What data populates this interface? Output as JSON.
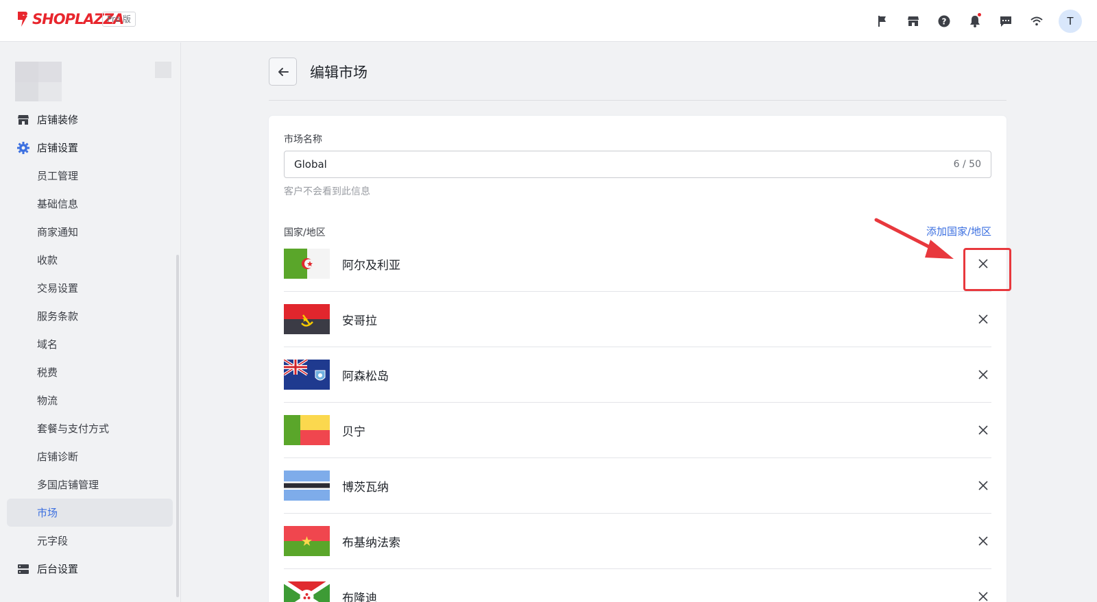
{
  "app": {
    "brand": "SHOPLAZZA",
    "edition": "Pro 版",
    "user_initial": "T"
  },
  "topbar_icons": [
    "flag-icon",
    "store-icon",
    "help-icon",
    "bell-icon",
    "chat-icon",
    "wifi-icon"
  ],
  "sidebar": {
    "items": [
      {
        "label": "店铺装修",
        "level": "top",
        "icon": "store-icon"
      },
      {
        "label": "店铺设置",
        "level": "top",
        "icon": "gear-icon"
      },
      {
        "label": "员工管理",
        "level": "sub"
      },
      {
        "label": "基础信息",
        "level": "sub"
      },
      {
        "label": "商家通知",
        "level": "sub"
      },
      {
        "label": "收款",
        "level": "sub"
      },
      {
        "label": "交易设置",
        "level": "sub"
      },
      {
        "label": "服务条款",
        "level": "sub"
      },
      {
        "label": "域名",
        "level": "sub"
      },
      {
        "label": "税费",
        "level": "sub"
      },
      {
        "label": "物流",
        "level": "sub"
      },
      {
        "label": "套餐与支付方式",
        "level": "sub"
      },
      {
        "label": "店铺诊断",
        "level": "sub"
      },
      {
        "label": "多国店铺管理",
        "level": "sub"
      },
      {
        "label": "市场",
        "level": "sub",
        "active": true
      },
      {
        "label": "元字段",
        "level": "sub"
      },
      {
        "label": "后台设置",
        "level": "top",
        "icon": "server-icon"
      }
    ]
  },
  "page": {
    "title": "编辑市场"
  },
  "form": {
    "market_name_label": "市场名称",
    "market_name_value": "Global",
    "market_name_counter": "6 / 50",
    "hint": "客户不会看到此信息",
    "regions_label": "国家/地区",
    "add_region": "添加国家/地区"
  },
  "countries": [
    {
      "name": "阿尔及利亚",
      "flag": "algeria-flag"
    },
    {
      "name": "安哥拉",
      "flag": "angola-flag"
    },
    {
      "name": "阿森松岛",
      "flag": "ascension-flag"
    },
    {
      "name": "贝宁",
      "flag": "benin-flag"
    },
    {
      "name": "博茨瓦纳",
      "flag": "botswana-flag"
    },
    {
      "name": "布基纳法索",
      "flag": "burkina-faso-flag"
    },
    {
      "name": "布隆迪",
      "flag": "burundi-flag"
    }
  ],
  "colors": {
    "accent": "#3b6fe0",
    "brand": "#e8262d",
    "annotation": "#e8383d"
  }
}
